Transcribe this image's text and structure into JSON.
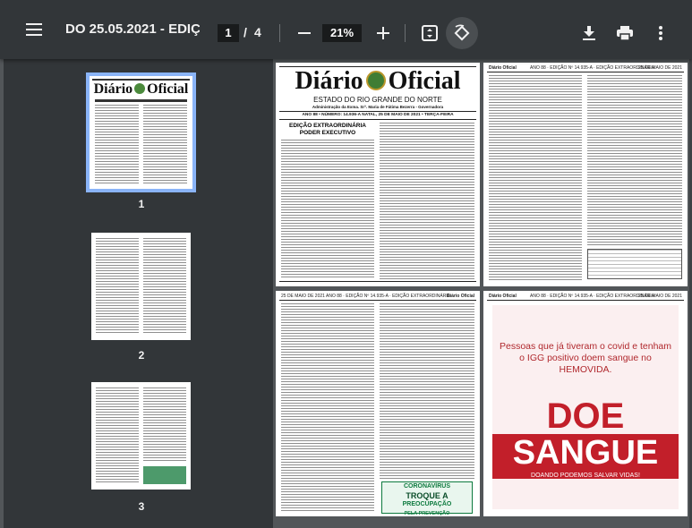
{
  "toolbar": {
    "title": "DO 25.05.2021 - EDIÇ...",
    "current_page": "1",
    "page_separator": "/",
    "total_pages": "4",
    "zoom": "21%"
  },
  "thumbnails": [
    {
      "label": "1",
      "selected": true
    },
    {
      "label": "2",
      "selected": false
    },
    {
      "label": "3",
      "selected": false
    }
  ],
  "page1": {
    "masthead_left": "Diário",
    "masthead_right": "Oficial",
    "state": "ESTADO DO RIO GRANDE DO NORTE",
    "admin": "Administração da Exma. Srª. Maria de Fátima Bezerra - Governadora",
    "issue_line": "ANO 88 • NÚMERO: 14.936-A    NATAL, 25 DE MAIO DE 2021 • TERÇA-FEIRA",
    "edition": "EDIÇÃO EXTRAORDINÁRIA",
    "branch": "PODER EXECUTIVO"
  },
  "page2": {
    "header_left": "Diário Oficial",
    "header_center": "ANO 88 · EDIÇÃO Nº 14.935-A · EDIÇÃO EXTRAORDINÁRIA",
    "header_right": "25 DE MAIO DE 2021"
  },
  "page3": {
    "header_left": "25 DE MAIO DE 2021",
    "header_center": "ANO 88 · EDIÇÃO Nº 14.935-A · EDIÇÃO EXTRAORDINÁRIA",
    "header_right": "Diário Oficial",
    "covid_line1": "CORONAVÍRUS",
    "covid_line2": "TROQUE A",
    "covid_line3": "PREOCUPAÇÃO",
    "covid_line4": "PELA PREVENÇÃO"
  },
  "page4": {
    "header_left": "Diário Oficial",
    "header_center": "ANO 88 · EDIÇÃO Nº 14.935-A · EDIÇÃO EXTRAORDINÁRIA",
    "header_right": "25 DE MAIO DE 2021",
    "message": "Pessoas que já tiveram o covid e tenham o IGG positivo doem sangue no HEMOVIDA.",
    "doe": "DOE",
    "sangue": "SANGUE",
    "tagline": "DOANDO PODEMOS SALVAR VIDAS!"
  },
  "colors": {
    "toolbar_bg": "#323639",
    "viewer_bg": "#525659",
    "selected_outline": "#8ab4f8",
    "blood_red": "#c21f2a"
  }
}
